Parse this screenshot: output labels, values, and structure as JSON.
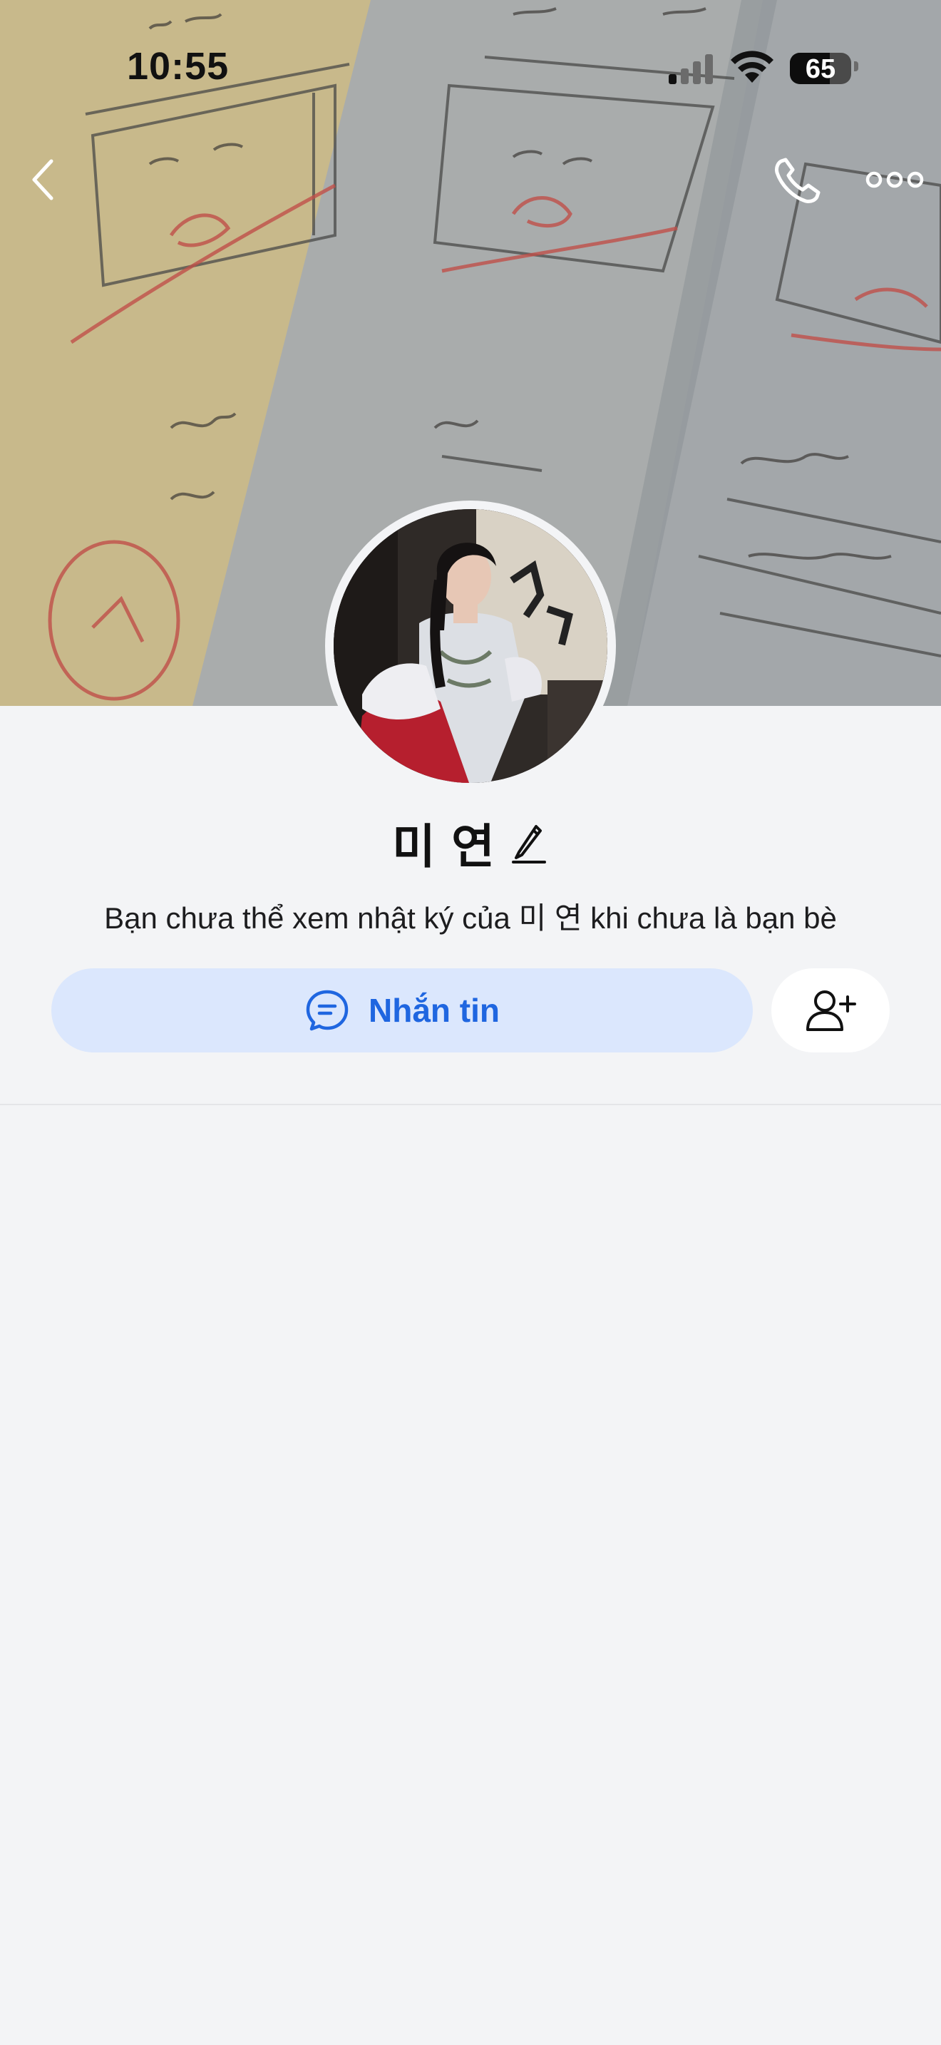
{
  "status_bar": {
    "time": "10:55",
    "battery_level": "65",
    "signal_icon": "cellular-signal-icon",
    "wifi_icon": "wifi-icon"
  },
  "nav": {
    "back_icon": "chevron-left-icon",
    "call_icon": "phone-icon",
    "more_icon": "more-horizontal-icon"
  },
  "profile": {
    "name": "미 연",
    "edit_icon": "pencil-icon",
    "privacy_note": "Bạn chưa thể xem nhật ký của 미 연 khi chưa là bạn bè"
  },
  "actions": {
    "message_label": "Nhắn tin",
    "message_icon": "chat-bubble-icon",
    "add_friend_icon": "add-friend-icon"
  },
  "colors": {
    "accent": "#1f66e0",
    "message_button_bg": "#dbe7fd",
    "page_bg": "#f3f4f6"
  }
}
